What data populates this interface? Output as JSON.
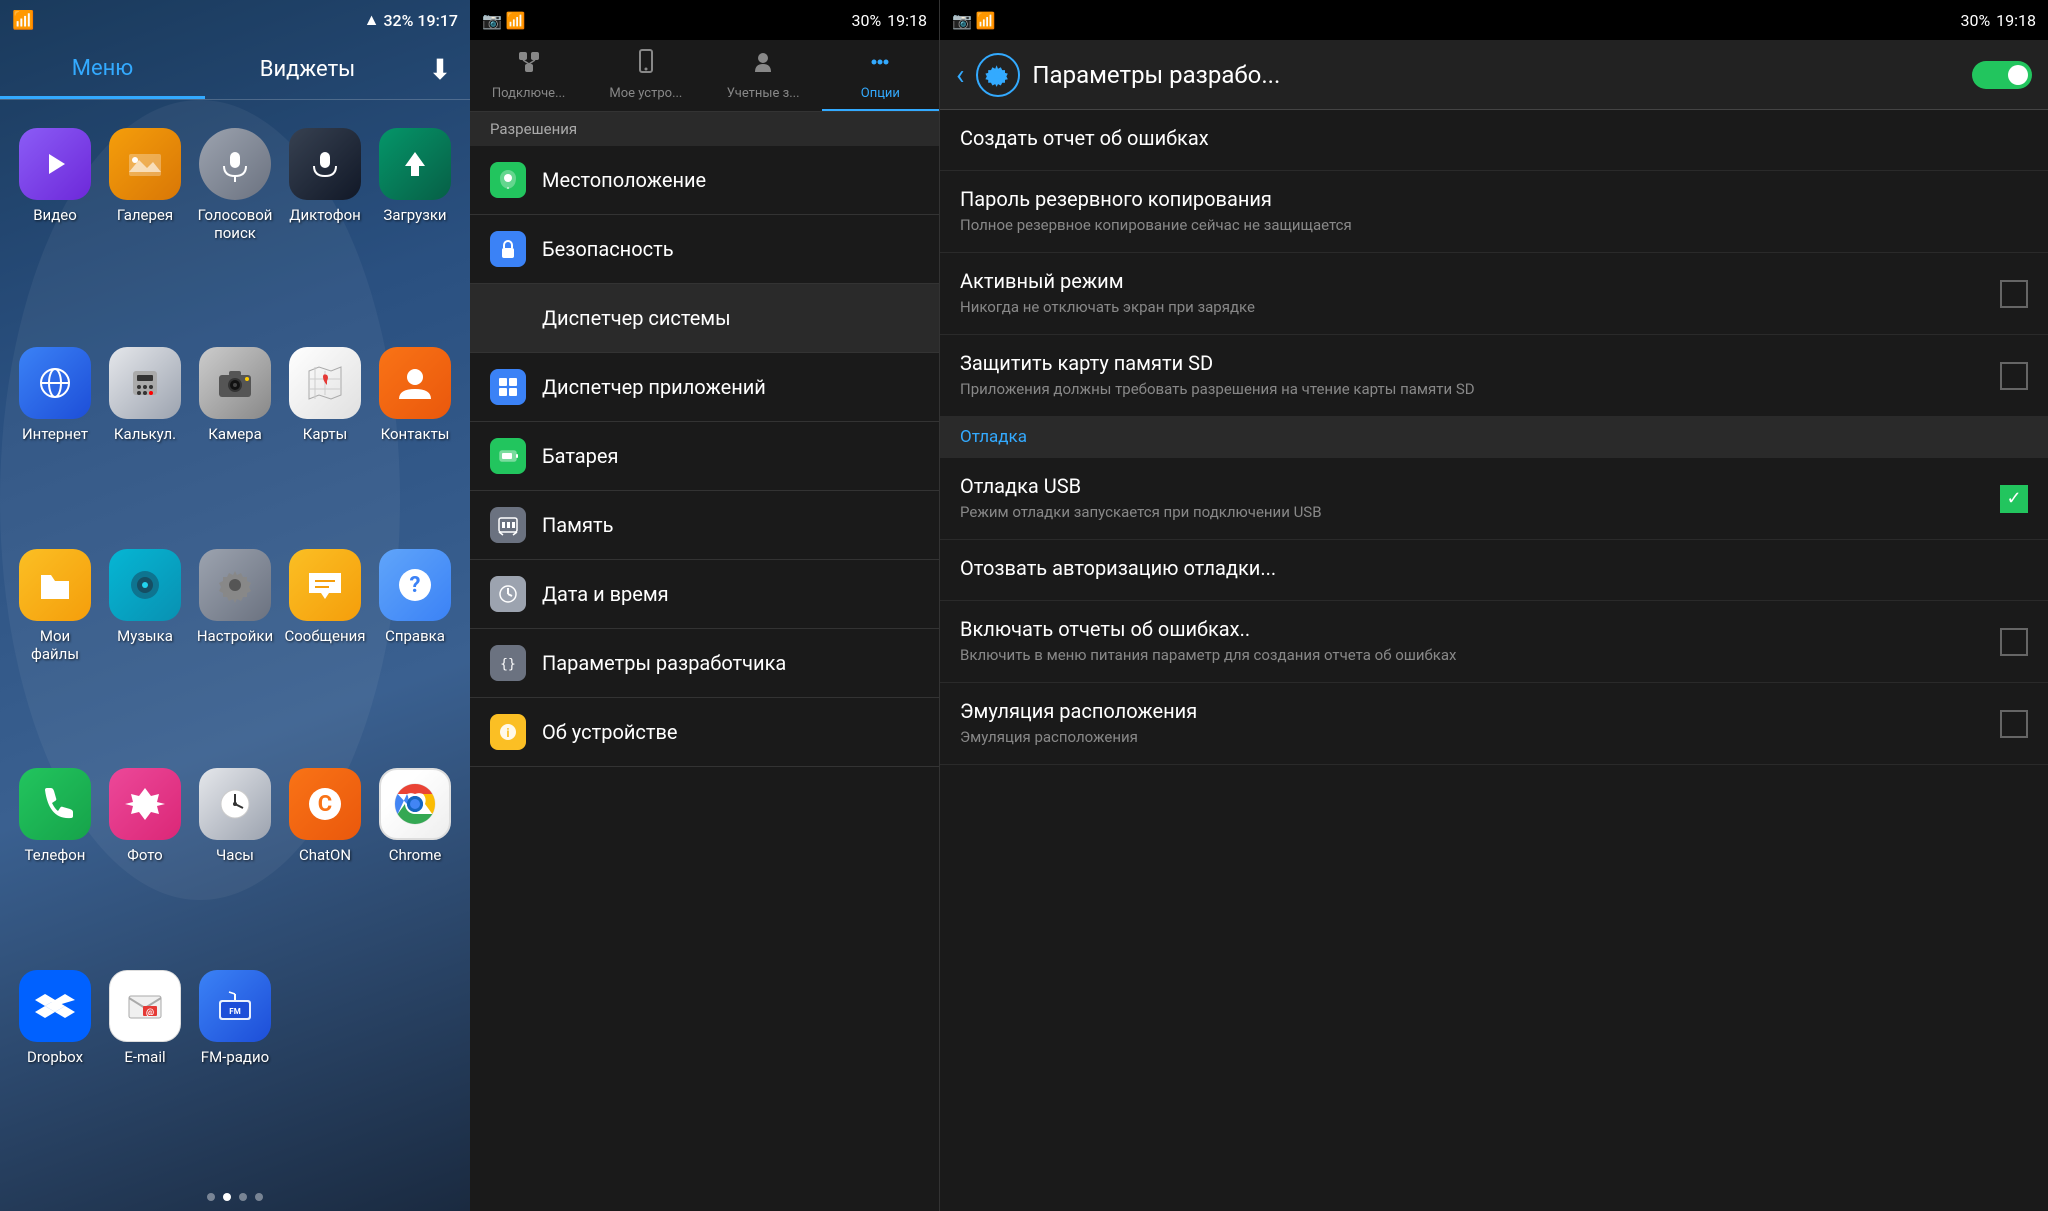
{
  "panel1": {
    "statusBar": {
      "wifi": "📶",
      "signal": "▲▲",
      "battery": "32%",
      "time": "19:17"
    },
    "tabs": [
      {
        "label": "Меню",
        "active": true
      },
      {
        "label": "Виджеты",
        "active": false
      }
    ],
    "downloadIcon": "⬇",
    "apps": [
      {
        "label": "Видео",
        "iconClass": "icon-video",
        "icon": "▶"
      },
      {
        "label": "Галерея",
        "iconClass": "icon-gallery",
        "icon": "🖼"
      },
      {
        "label": "Голосовой поиск",
        "iconClass": "icon-voice",
        "icon": "🎙"
      },
      {
        "label": "Диктофон",
        "iconClass": "icon-dictaphone",
        "icon": "🎤"
      },
      {
        "label": "Загрузки",
        "iconClass": "icon-downloads",
        "icon": "⬇"
      },
      {
        "label": "Интернет",
        "iconClass": "icon-internet",
        "icon": "🌐"
      },
      {
        "label": "Калькул.",
        "iconClass": "icon-calculator",
        "icon": "🔢"
      },
      {
        "label": "Камера",
        "iconClass": "icon-camera",
        "icon": "📷"
      },
      {
        "label": "Карты",
        "iconClass": "icon-maps",
        "icon": "🗺"
      },
      {
        "label": "Контакты",
        "iconClass": "icon-contacts",
        "icon": "👤"
      },
      {
        "label": "Мои файлы",
        "iconClass": "icon-myfiles",
        "icon": "📁"
      },
      {
        "label": "Музыка",
        "iconClass": "icon-music",
        "icon": "♪"
      },
      {
        "label": "Настройки",
        "iconClass": "icon-settings",
        "icon": "⚙"
      },
      {
        "label": "Сообщения",
        "iconClass": "icon-messages",
        "icon": "✉"
      },
      {
        "label": "Справка",
        "iconClass": "icon-help",
        "icon": "?"
      },
      {
        "label": "Телефон",
        "iconClass": "icon-phone",
        "icon": "📞"
      },
      {
        "label": "Фото",
        "iconClass": "icon-photos",
        "icon": "📸"
      },
      {
        "label": "Часы",
        "iconClass": "icon-clock",
        "icon": "🕐"
      },
      {
        "label": "ChatON",
        "iconClass": "icon-chaton",
        "icon": "C"
      },
      {
        "label": "Chrome",
        "iconClass": "icon-chrome",
        "icon": "🔵"
      },
      {
        "label": "Dropbox",
        "iconClass": "icon-dropbox",
        "icon": "📦"
      },
      {
        "label": "E-mail",
        "iconClass": "icon-email",
        "icon": "📧"
      },
      {
        "label": "FM-радио",
        "iconClass": "icon-fmradio",
        "icon": "📻"
      }
    ],
    "dots": [
      false,
      true,
      false,
      false
    ]
  },
  "panel2": {
    "statusBar": {
      "icons": "📷 📶",
      "battery": "30%",
      "time": "19:18"
    },
    "tabs": [
      {
        "label": "Подключе...",
        "icon": "🔌",
        "active": false
      },
      {
        "label": "Мое устро...",
        "icon": "📱",
        "active": false
      },
      {
        "label": "Учетные з...",
        "icon": "🔑",
        "active": false
      },
      {
        "label": "Опции",
        "icon": "⋯",
        "active": true
      }
    ],
    "sectionHeader": "Разрешения",
    "items": [
      {
        "label": "Местоположение",
        "icon": "📍",
        "iconBg": "#22C55E",
        "active": false
      },
      {
        "label": "Безопасность",
        "icon": "🔒",
        "iconBg": "#3B82F6",
        "active": false
      },
      {
        "label": "Диспетчер системы",
        "icon": "",
        "iconBg": "transparent",
        "active": true,
        "isSection": true
      },
      {
        "label": "Диспетчер приложений",
        "icon": "⊞",
        "iconBg": "#3B82F6",
        "active": false
      },
      {
        "label": "Батарея",
        "icon": "🔋",
        "iconBg": "#22C55E",
        "active": false
      },
      {
        "label": "Память",
        "icon": "💾",
        "iconBg": "#6B7280",
        "active": false
      },
      {
        "label": "Дата и время",
        "icon": "🕐",
        "iconBg": "#9CA3AF",
        "active": false
      },
      {
        "label": "Параметры разработчика",
        "icon": "{}",
        "iconBg": "#6B7280",
        "active": false
      },
      {
        "label": "Об устройстве",
        "icon": "ℹ",
        "iconBg": "#FBBF24",
        "active": false
      }
    ]
  },
  "panel3": {
    "statusBar": {
      "icons": "📷 📶",
      "battery": "30%",
      "time": "19:18"
    },
    "backLabel": "‹",
    "headerIcon": "⚙",
    "title": "Параметры разрабо...",
    "toggleOn": true,
    "options": [
      {
        "type": "item",
        "title": "Создать отчет об ошибках",
        "desc": "",
        "hasCheckbox": false
      },
      {
        "type": "item",
        "title": "Пароль резервного копирования",
        "desc": "Полное резервное копирование сейчас не защищается",
        "hasCheckbox": false
      },
      {
        "type": "item",
        "title": "Активный режим",
        "desc": "Никогда не отключать экран при зарядке",
        "hasCheckbox": true,
        "checked": false
      },
      {
        "type": "item",
        "title": "Защитить карту памяти SD",
        "desc": "Приложения должны требовать разрешения на чтение карты памяти SD",
        "hasCheckbox": true,
        "checked": false
      },
      {
        "type": "section",
        "title": "Отладка"
      },
      {
        "type": "item",
        "title": "Отладка USB",
        "desc": "Режим отладки запускается при подключении USB",
        "hasCheckbox": true,
        "checked": true
      },
      {
        "type": "item",
        "title": "Отозвать авторизацию отладки...",
        "desc": "",
        "hasCheckbox": false
      },
      {
        "type": "item",
        "title": "Включать отчеты об ошибках..",
        "desc": "Включить в меню питания параметр для создания отчета об ошибках",
        "hasCheckbox": true,
        "checked": false
      },
      {
        "type": "item",
        "title": "Эмуляция расположения",
        "desc": "Эмуляция расположения",
        "hasCheckbox": true,
        "checked": false
      }
    ]
  }
}
